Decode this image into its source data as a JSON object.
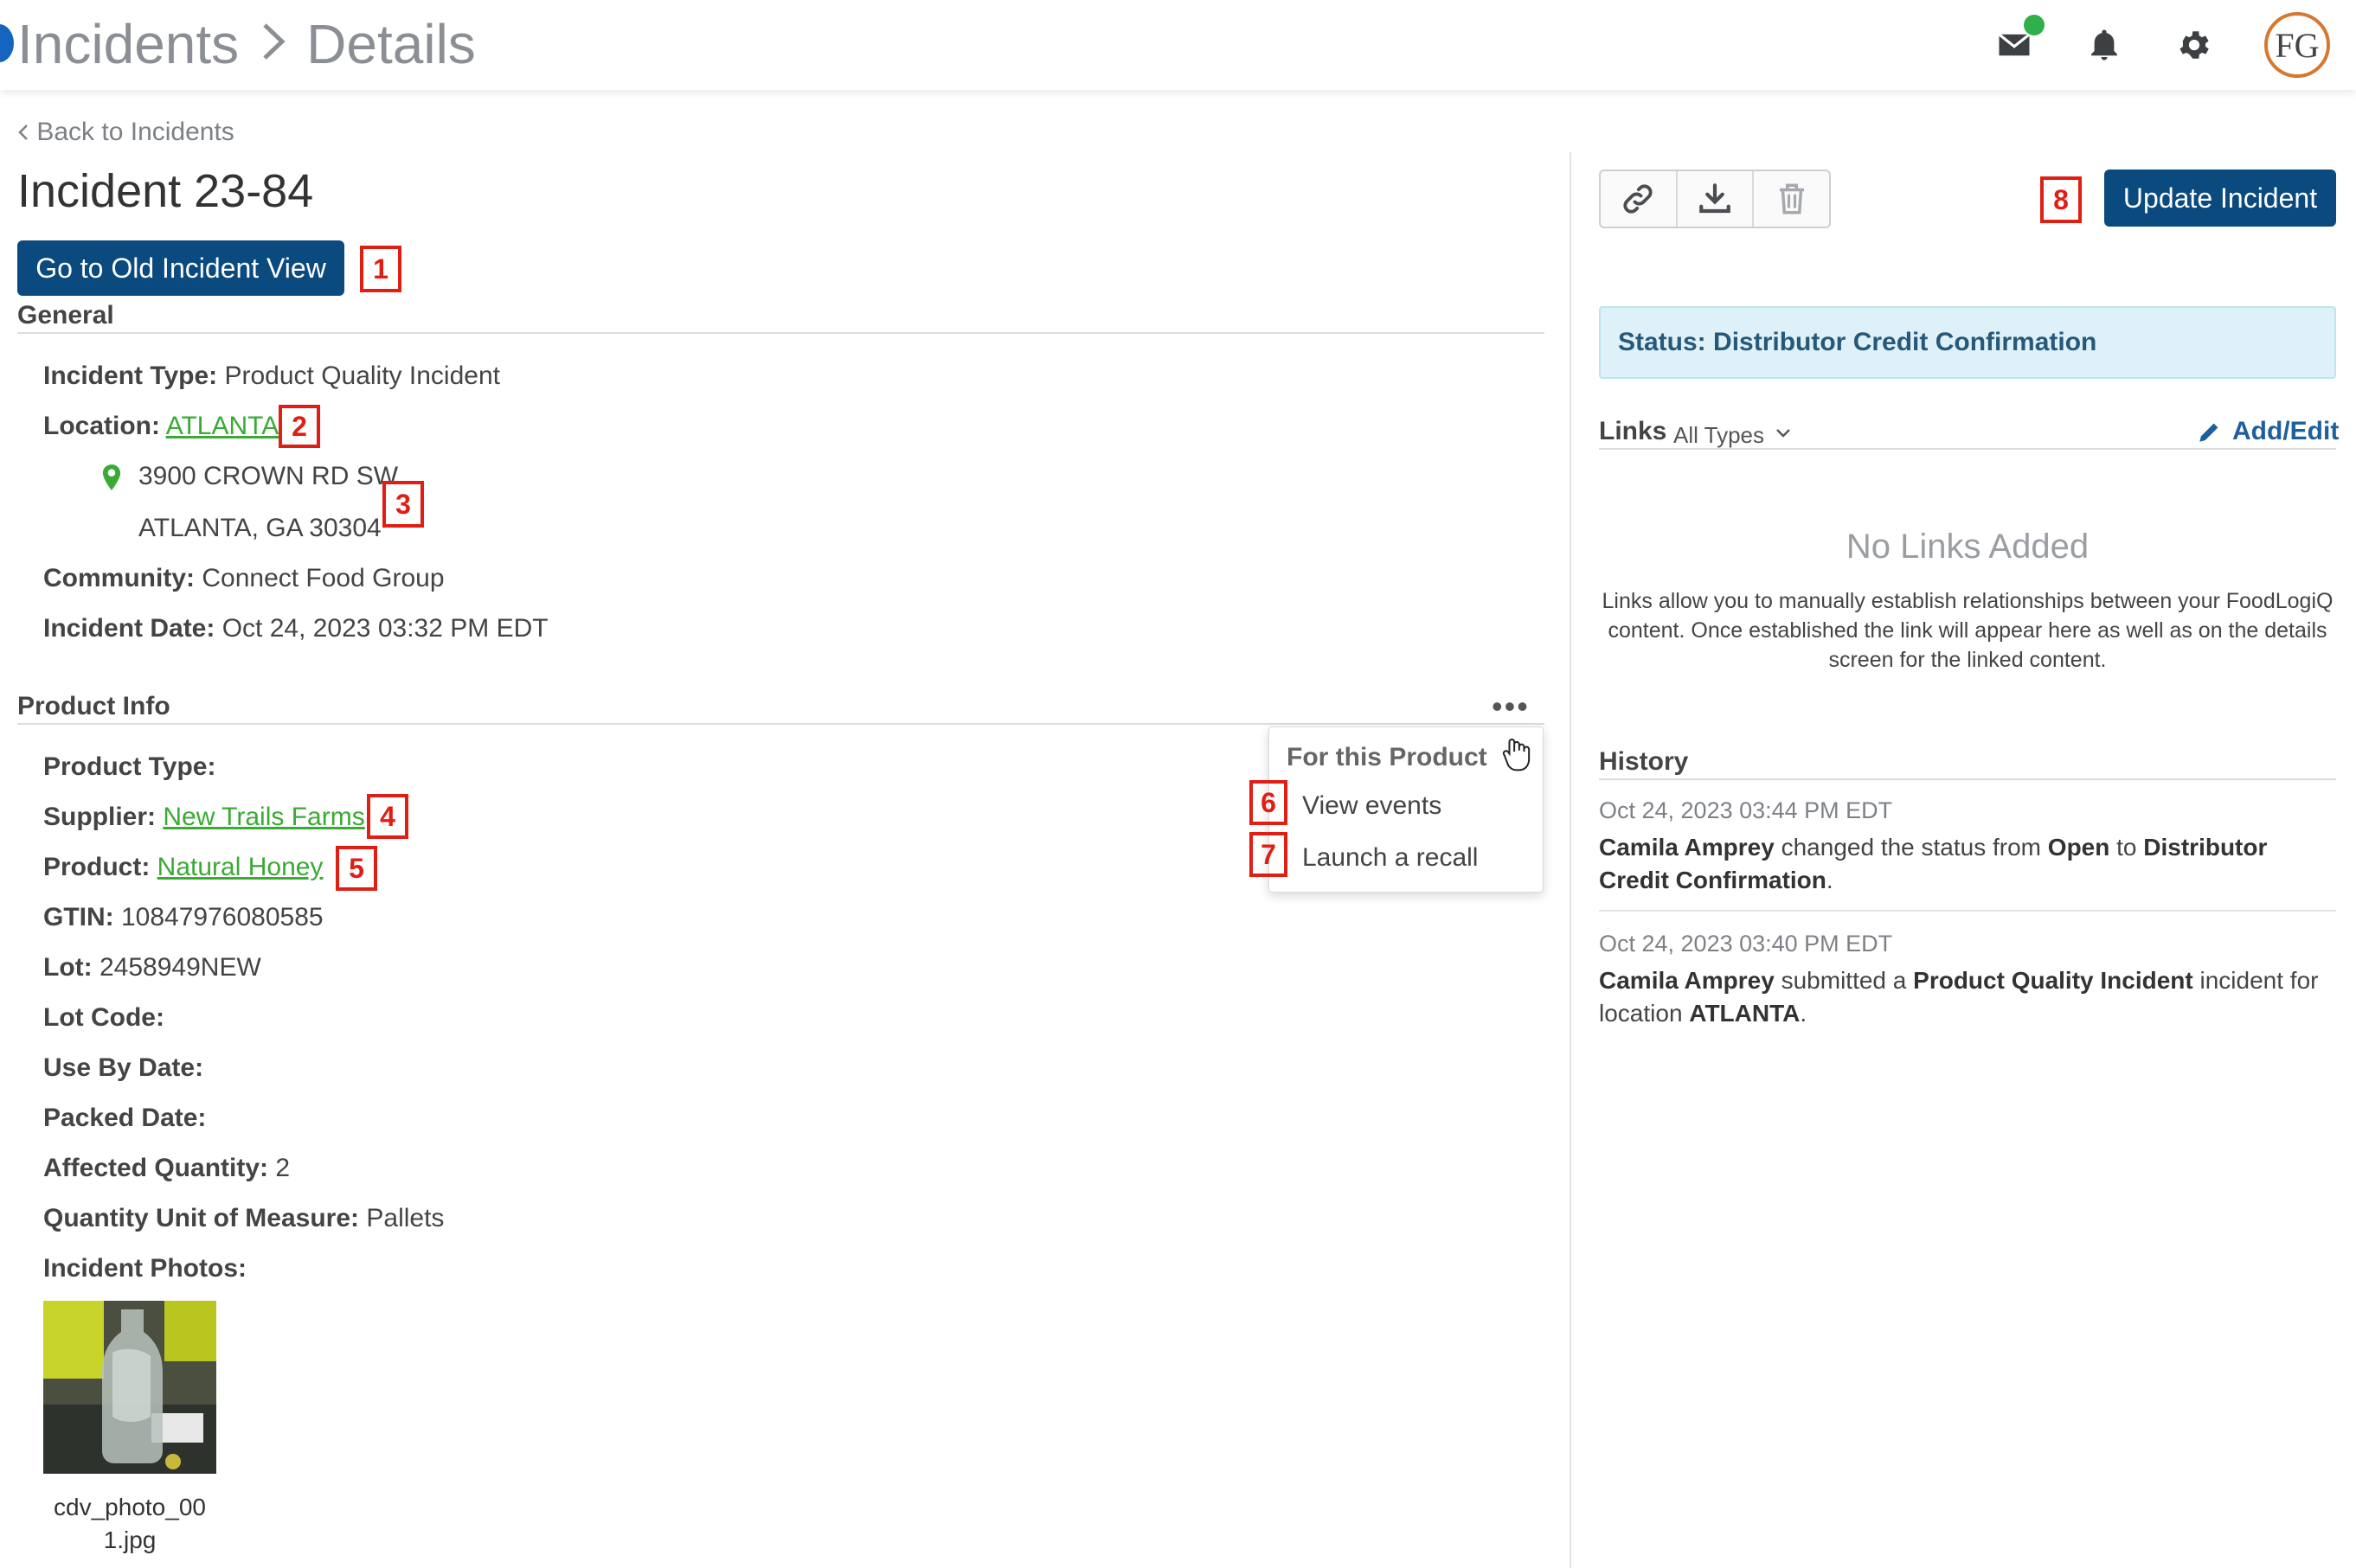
{
  "header": {
    "breadcrumb": [
      "Incidents",
      "Details"
    ],
    "avatar_initials": "FG",
    "icons": [
      "mail-icon",
      "bell-icon",
      "gear-icon"
    ]
  },
  "back_link": "Back to Incidents",
  "incident_title": "Incident 23-84",
  "old_view_button": "Go to Old Incident View",
  "markers": [
    "1",
    "2",
    "3",
    "4",
    "5",
    "6",
    "7",
    "8"
  ],
  "general": {
    "title": "General",
    "incident_type_label": "Incident Type:",
    "incident_type": "Product Quality Incident",
    "location_label": "Location:",
    "location": "ATLANTA",
    "address_line1": "3900 CROWN RD SW",
    "address_line2": "ATLANTA, GA 30304",
    "community_label": "Community:",
    "community": "Connect Food Group",
    "incident_date_label": "Incident Date:",
    "incident_date": "Oct 24, 2023 03:32 PM EDT"
  },
  "product_info": {
    "title": "Product Info",
    "product_type_label": "Product Type:",
    "product_type": "",
    "supplier_label": "Supplier:",
    "supplier": "New Trails Farms",
    "product_label": "Product:",
    "product": "Natural Honey",
    "gtin_label": "GTIN:",
    "gtin": "10847976080585",
    "lot_label": "Lot:",
    "lot": "2458949NEW",
    "lot_code_label": "Lot Code:",
    "use_by_label": "Use By Date:",
    "packed_label": "Packed Date:",
    "affected_qty_label": "Affected Quantity:",
    "affected_qty": "2",
    "uom_label": "Quantity Unit of Measure:",
    "uom": "Pallets",
    "photos_label": "Incident Photos:",
    "photo_caption_line1": "cdv_photo_00",
    "photo_caption_line2": "1.jpg"
  },
  "product_menu": {
    "kebab": "•••",
    "heading": "For this Product",
    "items": [
      "View events",
      "Launch a recall"
    ]
  },
  "right": {
    "update_button": "Update Incident",
    "status_label": "Status:",
    "status_value": "Distributor Credit Confirmation",
    "links_title": "Links",
    "links_filter": "All Types",
    "add_edit": "Add/Edit",
    "no_links_title": "No Links Added",
    "no_links_desc": "Links allow you to manually establish relationships between your FoodLogiQ content. Once established the link will appear here as well as on the details screen for the linked content.",
    "history_title": "History",
    "history": [
      {
        "date": "Oct 24, 2023 03:44 PM EDT",
        "user": "Camila Amprey",
        "t1": " changed the status from ",
        "b1": "Open",
        "t2": " to ",
        "b2": "Distributor Credit Confirmation",
        "t3": "."
      },
      {
        "date": "Oct 24, 2023 03:40 PM EDT",
        "user": "Camila Amprey",
        "t1": " submitted a ",
        "b1": "Product Quality Incident",
        "t2": " incident for location ",
        "b2": "ATLANTA",
        "t3": "."
      }
    ]
  }
}
